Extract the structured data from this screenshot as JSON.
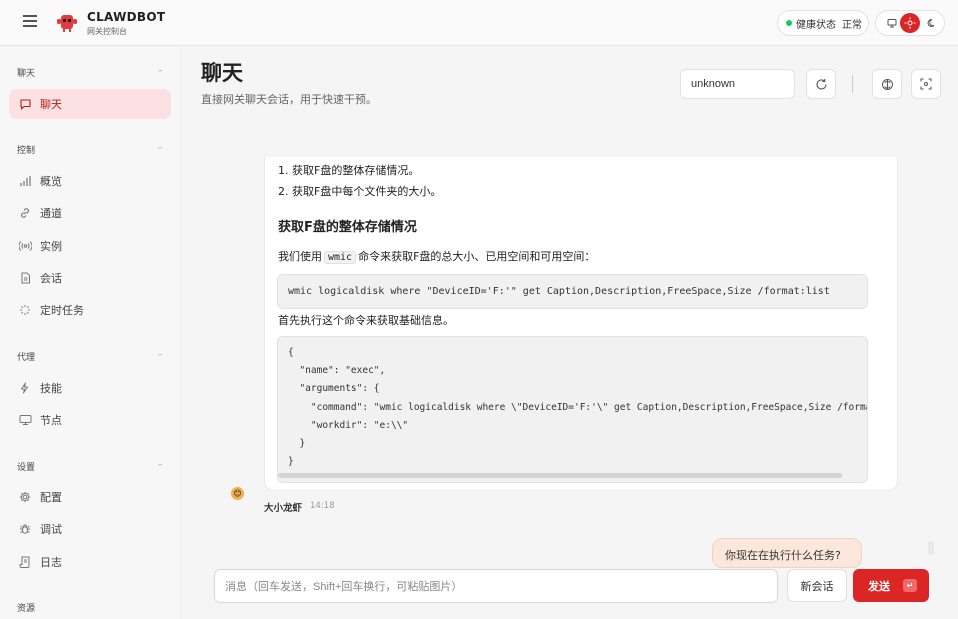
{
  "app": {
    "brand": "CLAWDBOT",
    "brand_sub": "网关控制台"
  },
  "header": {
    "health_label": "健康状态",
    "health_value": "正常",
    "colors": {
      "accent": "#dc2626",
      "health_ok": "#22c55e"
    },
    "theme_icons": [
      "monitor-icon",
      "sun-icon",
      "moon-icon"
    ]
  },
  "sidebar": {
    "sections": [
      {
        "title": "聊天",
        "items": [
          {
            "label": "聊天",
            "icon": "chat-bubble-icon",
            "active": true
          }
        ]
      },
      {
        "title": "控制",
        "items": [
          {
            "label": "概览",
            "icon": "bar-chart-icon"
          },
          {
            "label": "通道",
            "icon": "link-icon"
          },
          {
            "label": "实例",
            "icon": "broadcast-icon"
          },
          {
            "label": "会话",
            "icon": "file-icon"
          },
          {
            "label": "定时任务",
            "icon": "loader-icon"
          }
        ]
      },
      {
        "title": "代理",
        "items": [
          {
            "label": "技能",
            "icon": "zap-icon"
          },
          {
            "label": "节点",
            "icon": "monitor-icon"
          }
        ]
      },
      {
        "title": "设置",
        "items": [
          {
            "label": "配置",
            "icon": "gear-icon"
          },
          {
            "label": "调试",
            "icon": "bug-icon"
          },
          {
            "label": "日志",
            "icon": "scroll-icon"
          }
        ]
      },
      {
        "title": "资源",
        "items": []
      }
    ]
  },
  "page": {
    "title": "聊天",
    "subtitle": "直接网关聊天会话，用于快速干预。",
    "session_value": "unknown"
  },
  "chat": {
    "assistant": {
      "list": [
        "获取F盘的整体存储情况。",
        "获取F盘中每个文件夹的大小。"
      ],
      "heading": "获取F盘的整体存储情况",
      "para1_before": "我们使用",
      "para1_code": "wmic",
      "para1_after": "命令来获取F盘的总大小、已用空间和可用空间：",
      "code1": "wmic logicaldisk where \"DeviceID='F:'\" get Caption,Description,FreeSpace,Size /format:list",
      "para2": "首先执行这个命令来获取基础信息。",
      "code2": "{\n  \"name\": \"exec\",\n  \"arguments\": {\n    \"command\": \"wmic logicaldisk where \\\"DeviceID='F:'\\\" get Caption,Description,FreeSpace,Size /format:list\",\n    \"workdir\": \"e:\\\\\"\n  }\n}",
      "sender": "大小龙虾",
      "time": "14:18"
    },
    "user_message": "你现在在执行什么任务?"
  },
  "composer": {
    "placeholder": "消息（回车发送，Shift+回车换行，可粘贴图片）",
    "new_session": "新会话",
    "send": "发送"
  }
}
